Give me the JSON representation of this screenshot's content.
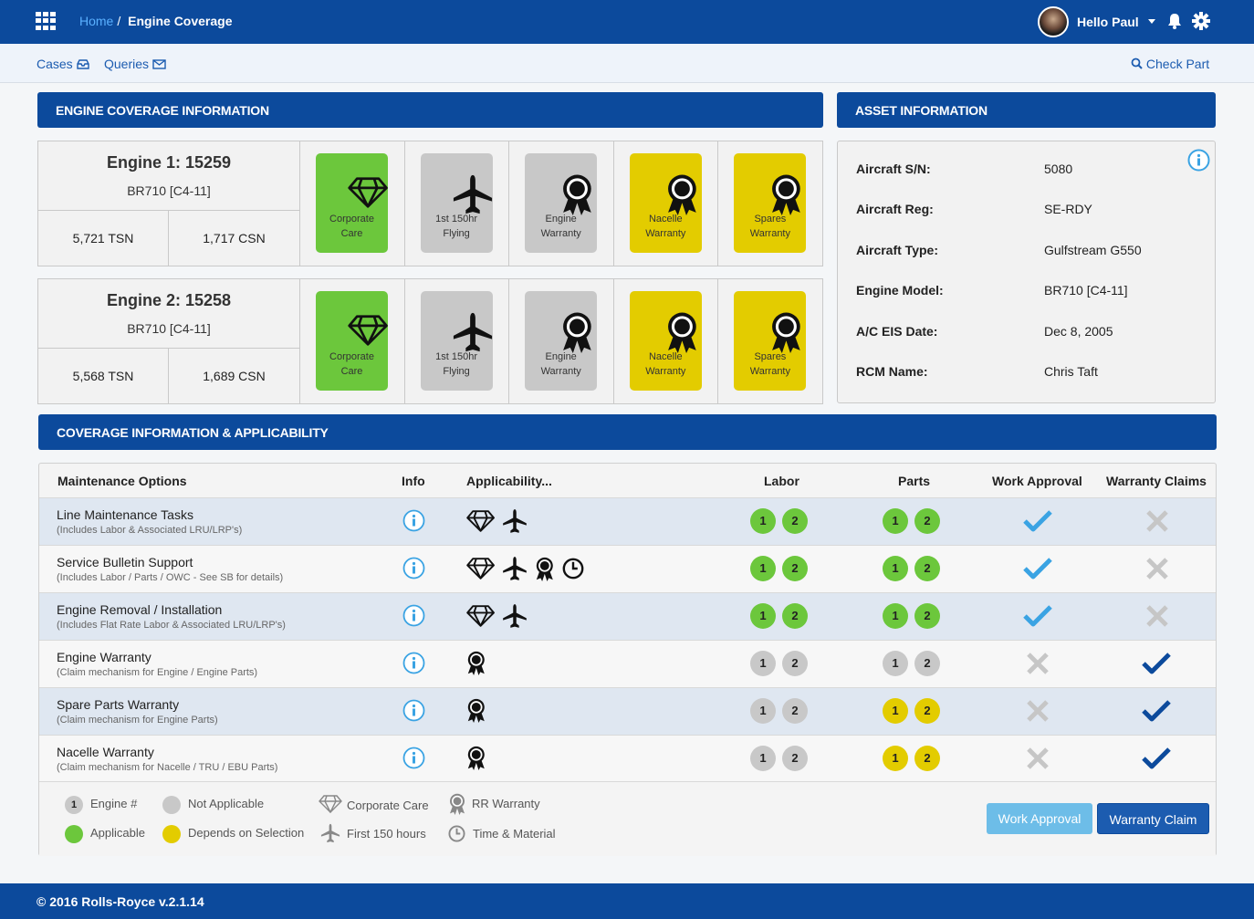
{
  "header": {
    "breadcrumb_home": "Home",
    "breadcrumb_sep": "/",
    "breadcrumb_current": "Engine Coverage",
    "user_greeting": "Hello Paul"
  },
  "subnav": {
    "cases": "Cases",
    "queries": "Queries",
    "check_part": "Check Part"
  },
  "engine_section": {
    "title": "ENGINE COVERAGE INFORMATION",
    "engines": [
      {
        "title": "Engine 1: 15259",
        "model": "BR710 [C4-11]",
        "tsn": "5,721 TSN",
        "csn": "1,717 CSN",
        "tiles": [
          {
            "line1": "Corporate",
            "line2": "Care",
            "status": "green",
            "icon": "diamond-icon"
          },
          {
            "line1": "1st 150hr",
            "line2": "Flying",
            "status": "grey",
            "icon": "airplane-icon"
          },
          {
            "line1": "Engine",
            "line2": "Warranty",
            "status": "grey",
            "icon": "award-ribbon-icon"
          },
          {
            "line1": "Nacelle",
            "line2": "Warranty",
            "status": "yellow",
            "icon": "award-ribbon-icon"
          },
          {
            "line1": "Spares",
            "line2": "Warranty",
            "status": "yellow",
            "icon": "award-ribbon-icon"
          }
        ]
      },
      {
        "title": "Engine 2: 15258",
        "model": "BR710 [C4-11]",
        "tsn": "5,568 TSN",
        "csn": "1,689 CSN",
        "tiles": [
          {
            "line1": "Corporate",
            "line2": "Care",
            "status": "green",
            "icon": "diamond-icon"
          },
          {
            "line1": "1st 150hr",
            "line2": "Flying",
            "status": "grey",
            "icon": "airplane-icon"
          },
          {
            "line1": "Engine",
            "line2": "Warranty",
            "status": "grey",
            "icon": "award-ribbon-icon"
          },
          {
            "line1": "Nacelle",
            "line2": "Warranty",
            "status": "yellow",
            "icon": "award-ribbon-icon"
          },
          {
            "line1": "Spares",
            "line2": "Warranty",
            "status": "yellow",
            "icon": "award-ribbon-icon"
          }
        ]
      }
    ]
  },
  "asset_section": {
    "title": "ASSET INFORMATION",
    "fields": [
      {
        "label": "Aircraft S/N:",
        "value": "5080"
      },
      {
        "label": "Aircraft Reg:",
        "value": "SE-RDY"
      },
      {
        "label": "Aircraft Type:",
        "value": "Gulfstream G550"
      },
      {
        "label": "Engine Model:",
        "value": "BR710 [C4-11]"
      },
      {
        "label": "A/C EIS Date:",
        "value": "Dec 8, 2005"
      },
      {
        "label": "RCM Name:",
        "value": "Chris Taft"
      }
    ]
  },
  "coverage": {
    "title": "COVERAGE INFORMATION & APPLICABILITY",
    "columns": {
      "options": "Maintenance Options",
      "info": "Info",
      "applicability": "Applicability...",
      "labor": "Labor",
      "parts": "Parts",
      "work_approval": "Work Approval",
      "warranty_claims": "Warranty Claims"
    },
    "rows": [
      {
        "title": "Line Maintenance Tasks",
        "sub": "(Includes Labor & Associated LRU/LRP's)",
        "apps": [
          "diamond-icon",
          "airplane-icon"
        ],
        "labor": "green",
        "parts": "green",
        "work_approval": "check-light",
        "warranty_claims": "x"
      },
      {
        "title": "Service Bulletin Support",
        "sub": "(Includes Labor / Parts / OWC - See SB for details)",
        "apps": [
          "diamond-icon",
          "airplane-icon",
          "award-ribbon-icon",
          "clock-icon"
        ],
        "labor": "green",
        "parts": "green",
        "work_approval": "check-light",
        "warranty_claims": "x"
      },
      {
        "title": "Engine Removal / Installation",
        "sub": "(Includes Flat Rate Labor & Associated LRU/LRP's)",
        "apps": [
          "diamond-icon",
          "airplane-icon"
        ],
        "labor": "green",
        "parts": "green",
        "work_approval": "check-light",
        "warranty_claims": "x"
      },
      {
        "title": "Engine Warranty",
        "sub": "(Claim mechanism for Engine / Engine Parts)",
        "apps": [
          "award-ribbon-icon"
        ],
        "labor": "grey",
        "parts": "grey",
        "work_approval": "x",
        "warranty_claims": "check-dark"
      },
      {
        "title": "Spare Parts Warranty",
        "sub": "(Claim mechanism for Engine Parts)",
        "apps": [
          "award-ribbon-icon"
        ],
        "labor": "grey",
        "parts": "yellow",
        "work_approval": "x",
        "warranty_claims": "check-dark"
      },
      {
        "title": "Nacelle Warranty",
        "sub": "(Claim mechanism for Nacelle / TRU / EBU Parts)",
        "apps": [
          "award-ribbon-icon"
        ],
        "labor": "grey",
        "parts": "yellow",
        "work_approval": "x",
        "warranty_claims": "check-dark"
      }
    ],
    "badge_1": "1",
    "badge_2": "2"
  },
  "legend": {
    "engine_num_badge": "1",
    "engine_num": "Engine #",
    "not_applicable": "Not Applicable",
    "applicable": "Applicable",
    "depends": "Depends on Selection",
    "corporate_care": "Corporate Care",
    "first_150": "First 150 hours",
    "rr_warranty": "RR Warranty",
    "time_material": "Time & Material"
  },
  "buttons": {
    "work_approval": "Work Approval",
    "warranty_claim": "Warranty Claim"
  },
  "footer": {
    "text": "© 2016 Rolls-Royce v.2.1.14"
  },
  "colors": {
    "brand_blue": "#0c4a9c",
    "green": "#6cc73c",
    "grey": "#c8c8c8",
    "yellow": "#e3cc00",
    "check_light": "#3aa3e3",
    "check_dark": "#0c4a9c",
    "x_grey": "#c6c6c6"
  }
}
